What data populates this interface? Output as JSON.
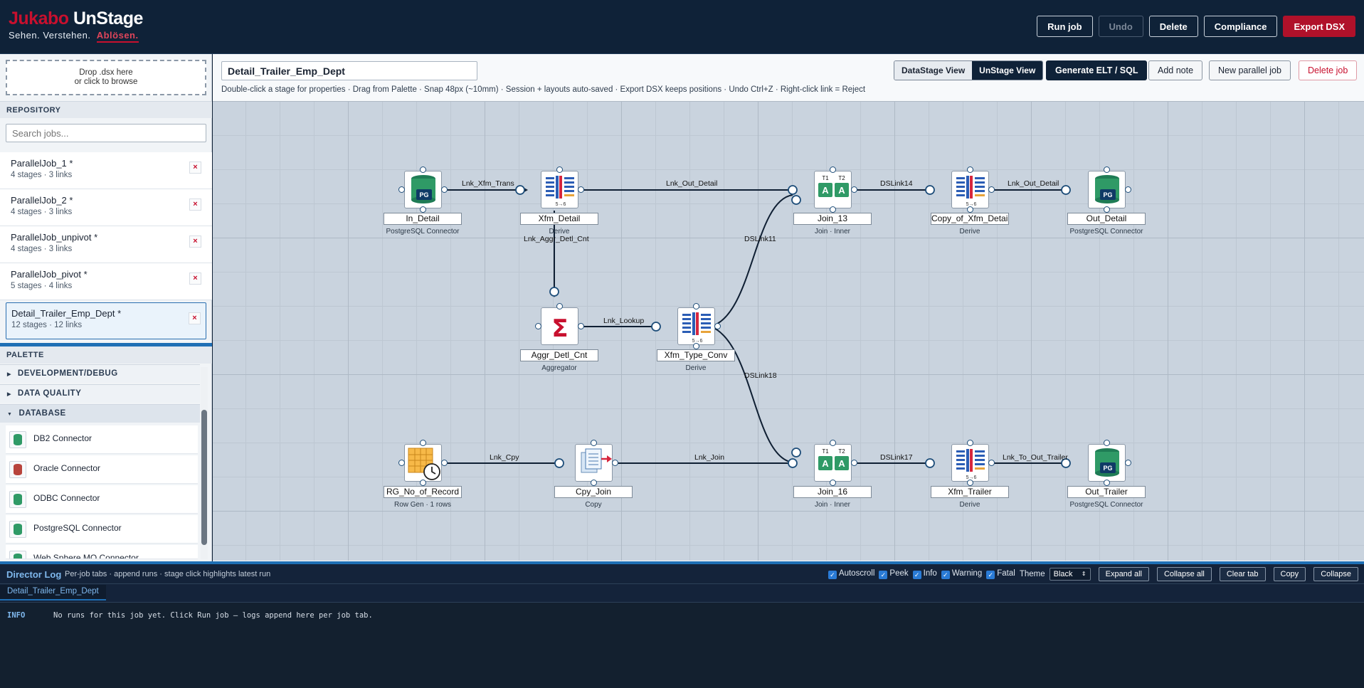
{
  "brand": {
    "logo_part1": "Jukabo",
    "logo_part2": "UnStage",
    "tag_part1": "Sehen. Verstehen.",
    "tag_accent": "Ablösen.",
    "accent_color": "#c8102e"
  },
  "top_actions": {
    "run_job": "Run job",
    "undo": "Undo",
    "delete": "Delete",
    "compliance": "Compliance",
    "export_dsx": "Export DSX"
  },
  "sidebar": {
    "drop_line1": "Drop .dsx here",
    "drop_line2": "or click to browse",
    "repository_heading": "REPOSITORY",
    "search_placeholder": "Search jobs...",
    "jobs": [
      {
        "name": "ParallelJob_1 *",
        "meta": "4 stages · 3 links"
      },
      {
        "name": "ParallelJob_2 *",
        "meta": "4 stages · 3 links"
      },
      {
        "name": "ParallelJob_unpivot *",
        "meta": "4 stages · 3 links"
      },
      {
        "name": "ParallelJob_pivot *",
        "meta": "5 stages · 4 links"
      },
      {
        "name": "Detail_Trailer_Emp_Dept *",
        "meta": "12 stages · 12 links"
      }
    ],
    "delete_icon": "×",
    "palette_heading": "PALETTE",
    "palette_categories": [
      {
        "label": "DEVELOPMENT/DEBUG",
        "arrow": "▶"
      },
      {
        "label": "DATA QUALITY",
        "arrow": "▶"
      },
      {
        "label": "DATABASE",
        "arrow": "▼"
      }
    ],
    "palette_items": [
      "DB2 Connector",
      "Oracle Connector",
      "ODBC Connector",
      "PostgreSQL Connector",
      "Web Sphere MQ Connector"
    ]
  },
  "main": {
    "job_title": "Detail_Trailer_Emp_Dept",
    "hint": "Double-click a stage for properties · Drag from Palette · Snap 48px (~10mm) · Session + layouts auto-saved · Export DSX keeps positions · Undo Ctrl+Z · Right-click link = Reject",
    "view_datastage": "DataStage View",
    "view_unstage": "UnStage View",
    "generate": "Generate ELT / SQL",
    "add_note": "Add note",
    "new_parallel": "New parallel job",
    "delete_job": "Delete job"
  },
  "stages": [
    {
      "name": "In_Detail",
      "type": "PostgreSQL Connector",
      "icon": "pg-icon"
    },
    {
      "name": "Xfm_Detail",
      "type": "Derive",
      "icon": "transformer-icon"
    },
    {
      "name": "Join_13",
      "type": "Join · Inner",
      "icon": "join-icon"
    },
    {
      "name": "Copy_of_Xfm_Detail",
      "type": "Derive",
      "icon": "transformer-icon"
    },
    {
      "name": "Out_Detail",
      "type": "PostgreSQL Connector",
      "icon": "pg-icon"
    },
    {
      "name": "Aggr_Detl_Cnt",
      "type": "Aggregator",
      "icon": "sigma-icon"
    },
    {
      "name": "Xfm_Type_Conv",
      "type": "Derive",
      "icon": "transformer-icon"
    },
    {
      "name": "RG_No_of_Record",
      "type": "Row Gen · 1 rows",
      "icon": "rowgen-icon"
    },
    {
      "name": "Cpy_Join",
      "type": "Copy",
      "icon": "copy-icon"
    },
    {
      "name": "Join_16",
      "type": "Join · Inner",
      "icon": "join-icon"
    },
    {
      "name": "Xfm_Trailer",
      "type": "Derive",
      "icon": "transformer-icon"
    },
    {
      "name": "Out_Trailer",
      "type": "PostgreSQL Connector",
      "icon": "pg-icon"
    }
  ],
  "links": [
    "Lnk_Xfm_Trans",
    "Lnk_Out_Detail",
    "DSLink14",
    "Lnk_Out_Detail",
    "Lnk_Aggr_Detl_Cnt",
    "Lnk_Lookup",
    "DSLink11",
    "DSLink18",
    "Lnk_Cpy",
    "Lnk_Join",
    "DSLink17",
    "Lnk_To_Out_Trailer"
  ],
  "icon_text": {
    "pg": "PG",
    "join_t1": "T1",
    "join_t2": "T2",
    "join_a": "A",
    "xfm_sub": "5→6",
    "sigma": "Σ"
  },
  "log": {
    "title": "Director Log",
    "subtitle": "Per-job tabs · append runs · stage click highlights latest run",
    "autoscroll": "Autoscroll",
    "peek": "Peek",
    "info": "Info",
    "warning": "Warning",
    "fatal": "Fatal",
    "theme_label": "Theme",
    "theme_value": "Black",
    "expand_all": "Expand all",
    "collapse_all": "Collapse all",
    "clear_tab": "Clear tab",
    "copy": "Copy",
    "collapse": "Collapse",
    "tab": "Detail_Trailer_Emp_Dept",
    "row_level": "INFO",
    "row_text": "No runs for this job yet. Click Run job — logs append here per job tab."
  }
}
